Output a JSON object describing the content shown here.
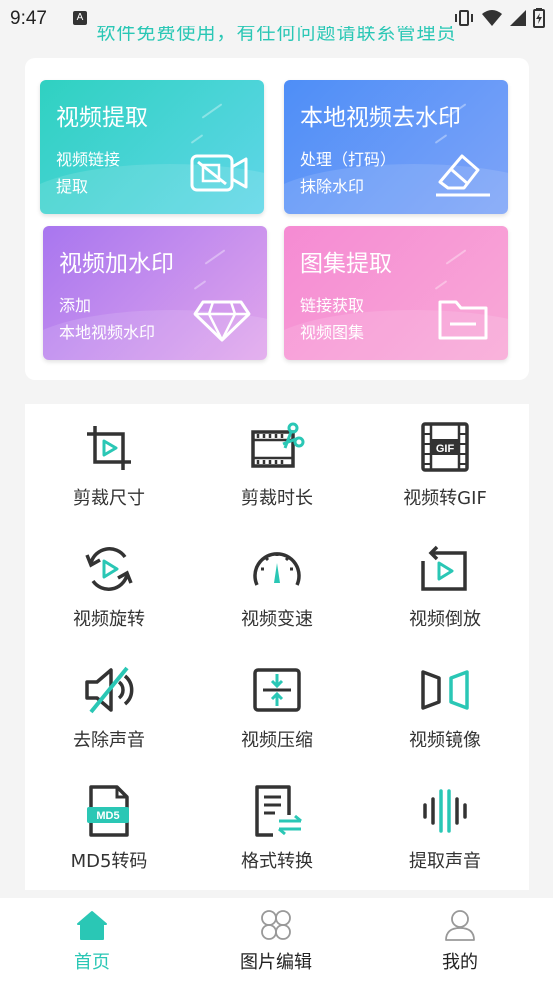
{
  "status_bar": {
    "time": "9:47",
    "notification_letter": "A"
  },
  "notice": "软件免费使用，有任何问题请联系管理员",
  "features": [
    {
      "title": "视频提取",
      "subtitle": "视频链接\n提取",
      "icon": "video-off-icon"
    },
    {
      "title": "本地视频去水印",
      "subtitle": "处理（打码）\n抹除水印",
      "icon": "eraser-icon"
    },
    {
      "title": "视频加水印",
      "subtitle": "添加\n本地视频水印",
      "icon": "diamond-icon"
    },
    {
      "title": "图集提取",
      "subtitle": "链接获取\n视频图集",
      "icon": "folder-icon"
    }
  ],
  "tools": [
    {
      "label": "剪裁尺寸",
      "icon": "crop-icon"
    },
    {
      "label": "剪裁时长",
      "icon": "film-scissors-icon"
    },
    {
      "label": "视频转GIF",
      "icon": "gif-film-icon"
    },
    {
      "label": "视频旋转",
      "icon": "rotate-icon"
    },
    {
      "label": "视频变速",
      "icon": "speedometer-icon"
    },
    {
      "label": "视频倒放",
      "icon": "reverse-play-icon"
    },
    {
      "label": "去除声音",
      "icon": "mute-icon"
    },
    {
      "label": "视频压缩",
      "icon": "compress-icon"
    },
    {
      "label": "视频镜像",
      "icon": "mirror-icon"
    },
    {
      "label": "MD5转码",
      "icon": "md5-file-icon"
    },
    {
      "label": "格式转换",
      "icon": "format-convert-icon"
    },
    {
      "label": "提取声音",
      "icon": "sound-wave-icon"
    }
  ],
  "tool_icon_text": {
    "gif": "GIF",
    "md5": "MD5"
  },
  "nav": [
    {
      "label": "首页",
      "icon": "home-icon",
      "active": true
    },
    {
      "label": "图片编辑",
      "icon": "grid-icon",
      "active": false
    },
    {
      "label": "我的",
      "icon": "user-icon",
      "active": false
    }
  ],
  "colors": {
    "accent": "#2ac7b5",
    "icon_dark": "#333333"
  }
}
